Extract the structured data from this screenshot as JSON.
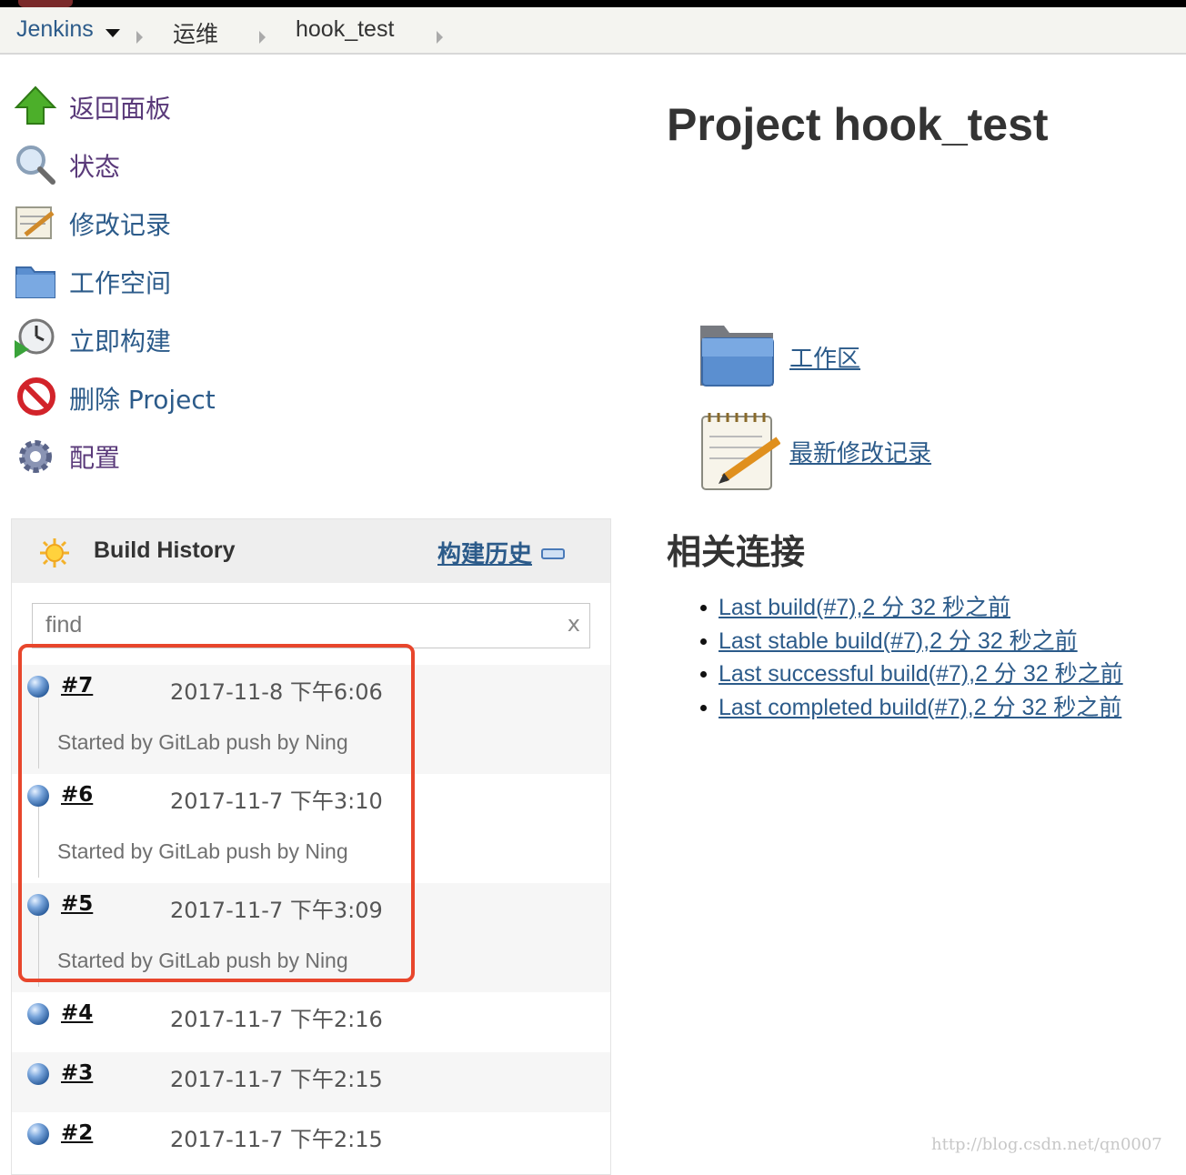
{
  "breadcrumb": {
    "root": "Jenkins",
    "folder": "运维",
    "job": "hook_test"
  },
  "tasks": [
    {
      "label": "返回面板",
      "icon": "up-arrow-icon"
    },
    {
      "label": "状态",
      "icon": "magnifier-icon"
    },
    {
      "label": "修改记录",
      "icon": "notepad-icon"
    },
    {
      "label": "工作空间",
      "icon": "folder-icon"
    },
    {
      "label": "立即构建",
      "icon": "clock-play-icon"
    },
    {
      "label": "删除 Project",
      "icon": "no-entry-icon"
    },
    {
      "label": "配置",
      "icon": "gear-icon"
    }
  ],
  "build_history": {
    "title": "Build History",
    "trend_label": "构建历史",
    "search_placeholder": "find",
    "clear_label": "x",
    "builds": [
      {
        "number": "#7",
        "date": "2017-11-8 下午6:06",
        "cause": "Started by GitLab push by Ning"
      },
      {
        "number": "#6",
        "date": "2017-11-7 下午3:10",
        "cause": "Started by GitLab push by Ning"
      },
      {
        "number": "#5",
        "date": "2017-11-7 下午3:09",
        "cause": "Started by GitLab push by Ning"
      },
      {
        "number": "#4",
        "date": "2017-11-7 下午2:16",
        "cause": ""
      },
      {
        "number": "#3",
        "date": "2017-11-7 下午2:15",
        "cause": ""
      },
      {
        "number": "#2",
        "date": "2017-11-7 下午2:15",
        "cause": ""
      }
    ]
  },
  "main": {
    "title": "Project hook_test",
    "workspace_link": "工作区",
    "changes_link": "最新修改记录",
    "related_heading": "相关连接",
    "related_links": [
      "Last build(#7),2 分 32 秒之前",
      "Last stable build(#7),2 分 32 秒之前",
      "Last successful build(#7),2 分 32 秒之前",
      "Last completed build(#7),2 分 32 秒之前"
    ]
  },
  "watermark": "http://blog.csdn.net/qn0007",
  "colors": {
    "link": "#2c5b8a",
    "highlight_box": "#e8462c",
    "header_bg": "#f4f4f0"
  }
}
